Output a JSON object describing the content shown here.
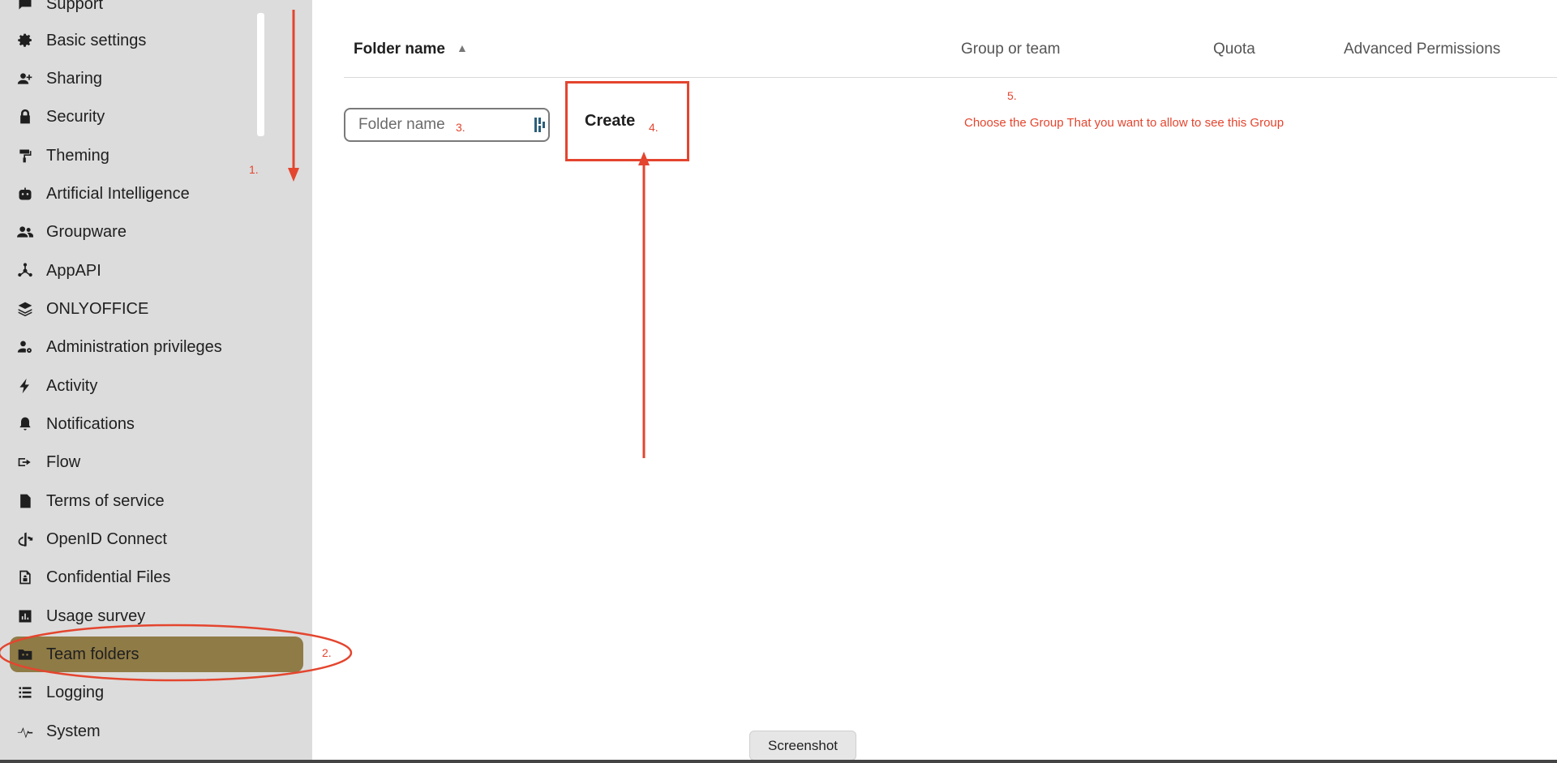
{
  "sidebar": {
    "items": [
      {
        "label": "Support",
        "icon": "chat-icon"
      },
      {
        "label": "Basic settings",
        "icon": "gear-icon"
      },
      {
        "label": "Sharing",
        "icon": "share-person-icon"
      },
      {
        "label": "Security",
        "icon": "lock-icon"
      },
      {
        "label": "Theming",
        "icon": "paint-roller-icon"
      },
      {
        "label": "Artificial Intelligence",
        "icon": "robot-icon"
      },
      {
        "label": "Groupware",
        "icon": "people-icon"
      },
      {
        "label": "AppAPI",
        "icon": "hub-icon"
      },
      {
        "label": "ONLYOFFICE",
        "icon": "layers-icon"
      },
      {
        "label": "Administration privileges",
        "icon": "person-gear-icon"
      },
      {
        "label": "Activity",
        "icon": "lightning-icon"
      },
      {
        "label": "Notifications",
        "icon": "bell-icon"
      },
      {
        "label": "Flow",
        "icon": "flow-arrow-icon"
      },
      {
        "label": "Terms of service",
        "icon": "document-icon"
      },
      {
        "label": "OpenID Connect",
        "icon": "openid-icon"
      },
      {
        "label": "Confidential Files",
        "icon": "confidential-file-icon"
      },
      {
        "label": "Usage survey",
        "icon": "bar-chart-icon"
      },
      {
        "label": "Team folders",
        "icon": "team-folder-icon",
        "active": true
      },
      {
        "label": "Logging",
        "icon": "list-icon"
      },
      {
        "label": "System",
        "icon": "pulse-icon"
      }
    ]
  },
  "table": {
    "columns": {
      "folder_name": "Folder name",
      "group": "Group or team",
      "quota": "Quota",
      "advanced": "Advanced Permissions"
    },
    "sort_indicator": "▲"
  },
  "new_folder": {
    "placeholder": "Folder name",
    "create_label": "Create"
  },
  "annotations": {
    "step1": "1.",
    "step2": "2.",
    "step3": "3.",
    "step4": "4.",
    "step5": "5.",
    "step5_text": "Choose the Group That you want to allow to see this Group",
    "color": "#e4452e"
  },
  "screenshot_button": "Screenshot",
  "colors": {
    "sidebar_bg": "#dcdcdc",
    "active_item_bg": "#8f7b46"
  }
}
